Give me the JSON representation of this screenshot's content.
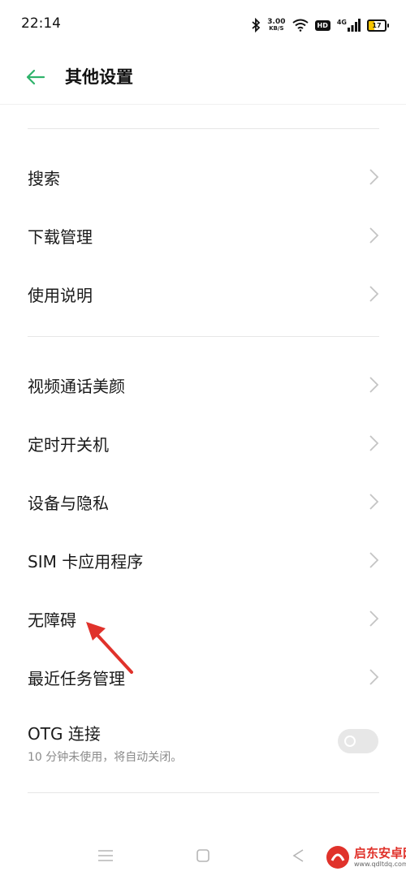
{
  "status_bar": {
    "time": "22:14",
    "net_speed_value": "3.00",
    "net_speed_unit": "KB/S",
    "hd_label": "HD",
    "network_label": "4G",
    "battery_level": "17"
  },
  "header": {
    "title": "其他设置",
    "back_icon": "arrow-left-icon",
    "accent_color": "#2fb36b"
  },
  "sections": [
    {
      "items": [
        {
          "label": "搜索"
        },
        {
          "label": "下载管理"
        },
        {
          "label": "使用说明"
        }
      ]
    },
    {
      "items": [
        {
          "label": "视频通话美颜"
        },
        {
          "label": "定时开关机"
        },
        {
          "label": "设备与隐私"
        },
        {
          "label": "SIM 卡应用程序"
        },
        {
          "label": "无障碍"
        },
        {
          "label": "最近任务管理"
        }
      ]
    }
  ],
  "otg": {
    "label": "OTG 连接",
    "subtitle": "10 分钟未使用，将自动关闭。",
    "enabled": false
  },
  "annotation": {
    "arrow_color": "#e0322b"
  },
  "watermark": {
    "name": "启东安卓网",
    "url": "www.qdltdq.com"
  }
}
